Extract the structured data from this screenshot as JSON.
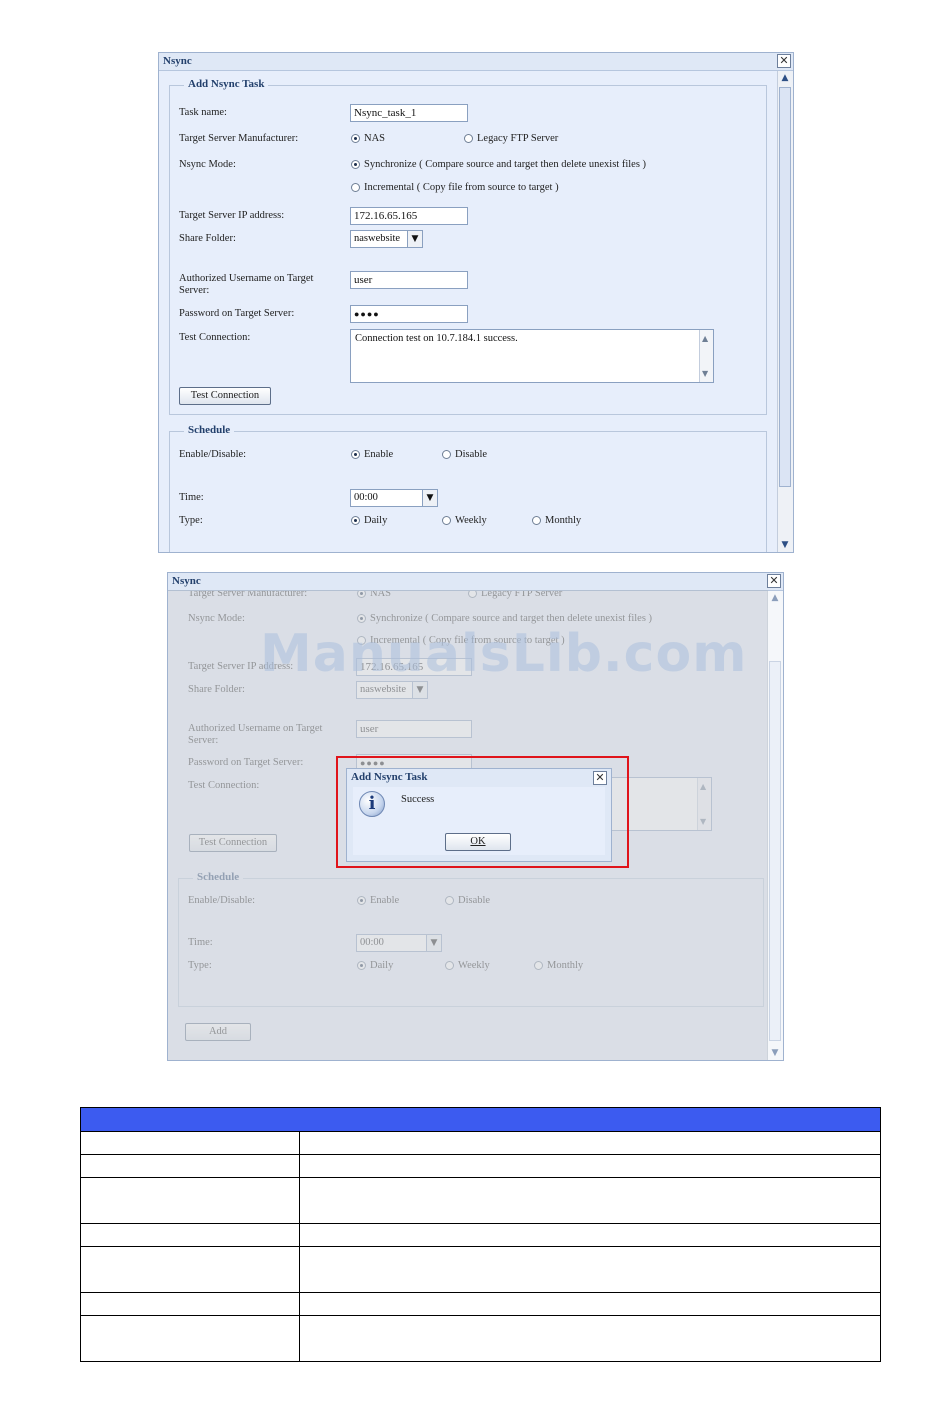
{
  "window1": {
    "title": "Nsync",
    "close_glyph": "✕",
    "add_task": {
      "legend": "Add Nsync Task",
      "task_name_label": "Task name:",
      "task_name_value": "Nsync_task_1",
      "manufacturer_label": "Target Server Manufacturer:",
      "manufacturer_options": [
        "NAS",
        "Legacy FTP Server"
      ],
      "manufacturer_selected": "NAS",
      "mode_label": "Nsync Mode:",
      "mode_options": [
        "Synchronize ( Compare source and target then delete unexist files )",
        "Incremental ( Copy file from source to target )"
      ],
      "mode_selected": "Synchronize",
      "ip_label": "Target Server IP address:",
      "ip_value": "172.16.65.165",
      "share_label": "Share Folder:",
      "share_value": "naswebsite",
      "username_label": "Authorized Username on Target Server:",
      "username_value": "user",
      "password_label": "Password on Target Server:",
      "password_value": "●●●●",
      "test_label": "Test Connection:",
      "test_result": "Connection test on 10.7.184.1 success.",
      "test_button": "Test Connection"
    },
    "schedule": {
      "legend": "Schedule",
      "enable_label": "Enable/Disable:",
      "enable_options": [
        "Enable",
        "Disable"
      ],
      "enable_selected": "Enable",
      "time_label": "Time:",
      "time_value": "00:00",
      "type_label": "Type:",
      "type_options": [
        "Daily",
        "Weekly",
        "Monthly"
      ],
      "type_selected": "Daily"
    }
  },
  "window2": {
    "title": "Nsync",
    "close_glyph": "✕",
    "manufacturer_label_partial": "Target Server Manufacturer:",
    "manufacturer_options": [
      "NAS",
      "Legacy FTP Server"
    ],
    "mode_label": "Nsync Mode:",
    "mode_options": [
      "Synchronize ( Compare source and target then delete unexist files )",
      "Incremental ( Copy file from source to target )"
    ],
    "ip_label": "Target Server IP address:",
    "ip_value": "172.16.65.165",
    "share_label": "Share Folder:",
    "share_value": "naswebsite",
    "username_label": "Authorized Username on Target Server:",
    "username_value": "user",
    "password_label": "Password on Target Server:",
    "password_value": "●●●●",
    "test_label": "Test Connection:",
    "test_button": "Test Connection",
    "schedule_legend": "Schedule",
    "enable_label": "Enable/Disable:",
    "enable_options": [
      "Enable",
      "Disable"
    ],
    "time_label": "Time:",
    "time_value": "00:00",
    "type_label": "Type:",
    "type_options": [
      "Daily",
      "Weekly",
      "Monthly"
    ],
    "add_button": "Add",
    "watermark": "ManualsLib.com"
  },
  "dialog": {
    "title": "Add Nsync Task",
    "message": "Success",
    "ok_button": "OK",
    "close_glyph": "✕",
    "icon_glyph": "i"
  },
  "desc_table": {
    "rows": 7,
    "header_color": "#3c5bf0"
  }
}
